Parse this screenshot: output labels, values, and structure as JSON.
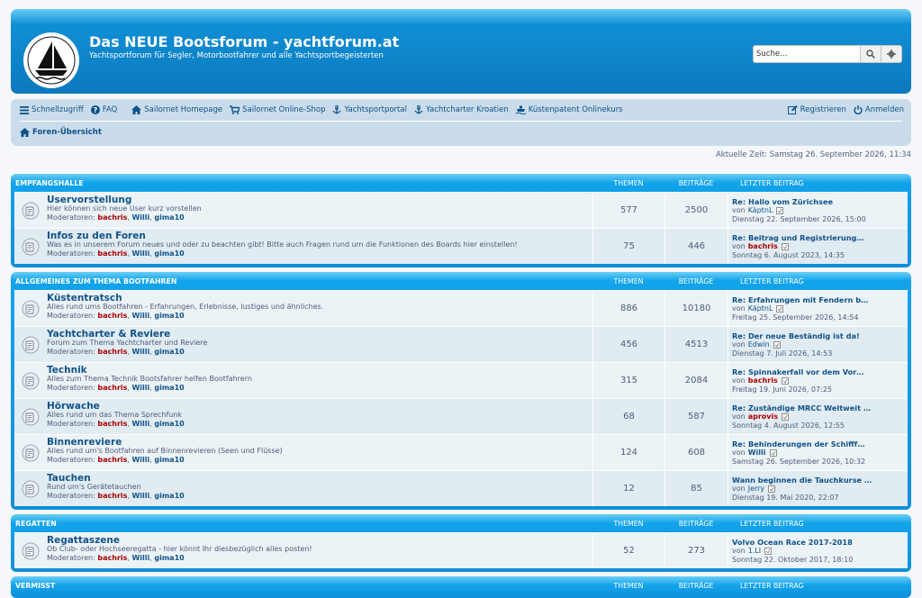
{
  "header": {
    "title": "Das NEUE Bootsforum - yachtforum.at",
    "description": "Yachtsportforum für Segler, Motorbootfahrer und alle Yachtsportbegeisterten",
    "search_placeholder": "Suche…"
  },
  "nav": {
    "quick_links": "Schnellzugriff",
    "faq": "FAQ",
    "homepage": "Sailornet Homepage",
    "shop": "Sailornet Online-Shop",
    "portal": "Yachtsportportal",
    "charter": "Yachtcharter Kroatien",
    "license": "Küstenpatent Onlinekurs",
    "register": "Registrieren",
    "login": "Anmelden",
    "breadcrumb": "Foren-Übersicht"
  },
  "current_time": "Aktuelle Zeit: Samstag 26. September 2026, 11:34",
  "columns": {
    "topics": "THEMEN",
    "posts": "BEITRÄGE",
    "last_post": "LETZTER BEITRAG"
  },
  "moderators_label": "Moderatoren:",
  "moderators": [
    "bachris",
    "Willi",
    "gima10"
  ],
  "by_label": "von",
  "categories": [
    {
      "name": "EMPFANGSHALLE",
      "forums": [
        {
          "title": "Uservorstellung",
          "desc": "Hier können sich neue User kurz vorstellen",
          "topics": "577",
          "posts": "2500",
          "last_title": "Re: Hallo vom Zürichsee",
          "last_user": "KäptnL",
          "last_user_style": "plain",
          "last_date": "Dienstag 22. September 2026, 15:00"
        },
        {
          "title": "Infos zu den Foren",
          "desc": "Was es in unserem Forum neues und oder zu beachten gibt! Bitte auch Fragen rund um die Funktionen des Boards hier einstellen!",
          "topics": "75",
          "posts": "446",
          "last_title": "Re: Beitrag und Registrierung…",
          "last_user": "bachris",
          "last_user_style": "red",
          "last_date": "Sonntag 6. August 2023, 14:35"
        }
      ]
    },
    {
      "name": "ALLGEMEINES ZUM THEMA BOOTFAHREN",
      "forums": [
        {
          "title": "Küstentratsch",
          "desc": "Alles rund ums Bootfahren - Erfahrungen, Erlebnisse, lustiges und ähnliches.",
          "topics": "886",
          "posts": "10180",
          "last_title": "Re: Erfahrungen mit Fendern b…",
          "last_user": "KäptnL",
          "last_user_style": "plain",
          "last_date": "Freitag 25. September 2026, 14:54"
        },
        {
          "title": "Yachtcharter & Reviere",
          "desc": "Forum zum Thema Yachtcharter und Reviere",
          "topics": "456",
          "posts": "4513",
          "last_title": "Re: Der neue Beständig ist da!",
          "last_user": "Edwin",
          "last_user_style": "plain",
          "last_date": "Dienstag 7. Juli 2026, 14:53"
        },
        {
          "title": "Technik",
          "desc": "Alles zum Thema Technik Bootsfahrer helfen Bootfahrern",
          "topics": "315",
          "posts": "2084",
          "last_title": "Re: Spinnakerfall vor dem Vor…",
          "last_user": "bachris",
          "last_user_style": "red",
          "last_date": "Freitag 19. Juni 2026, 07:25"
        },
        {
          "title": "Hörwache",
          "desc": "Alles rund um das Thema Sprechfunk",
          "topics": "68",
          "posts": "587",
          "last_title": "Re: Zuständige MRCC Weltweit …",
          "last_user": "aprovis",
          "last_user_style": "red",
          "last_date": "Sonntag 4. August 2026, 12:55"
        },
        {
          "title": "Binnenreviere",
          "desc": "Alles rund um's Bootfahren auf Binnenrevieren (Seen und Flüsse)",
          "topics": "124",
          "posts": "608",
          "last_title": "Re: Behinderungen der Schifff…",
          "last_user": "Willi",
          "last_user_style": "blue",
          "last_date": "Samstag 26. September 2026, 10:32"
        },
        {
          "title": "Tauchen",
          "desc": "Rund um's Gerätetauchen",
          "topics": "12",
          "posts": "85",
          "last_title": "Wann beginnen die Tauchkurse …",
          "last_user": "Jerry",
          "last_user_style": "plain",
          "last_date": "Dienstag 19. Mai 2020, 22:07"
        }
      ]
    },
    {
      "name": "REGATTEN",
      "forums": [
        {
          "title": "Regattaszene",
          "desc": "Ob Club- oder Hochseeregatta - hier könnt Ihr diesbezüglich alles posten!",
          "topics": "52",
          "posts": "273",
          "last_title": "Volvo Ocean Race 2017-2018",
          "last_user": "1.LI",
          "last_user_style": "plain",
          "last_date": "Sonntag 22. Oktober 2017, 18:10"
        }
      ]
    },
    {
      "name": "VERMISST",
      "forums": []
    }
  ]
}
